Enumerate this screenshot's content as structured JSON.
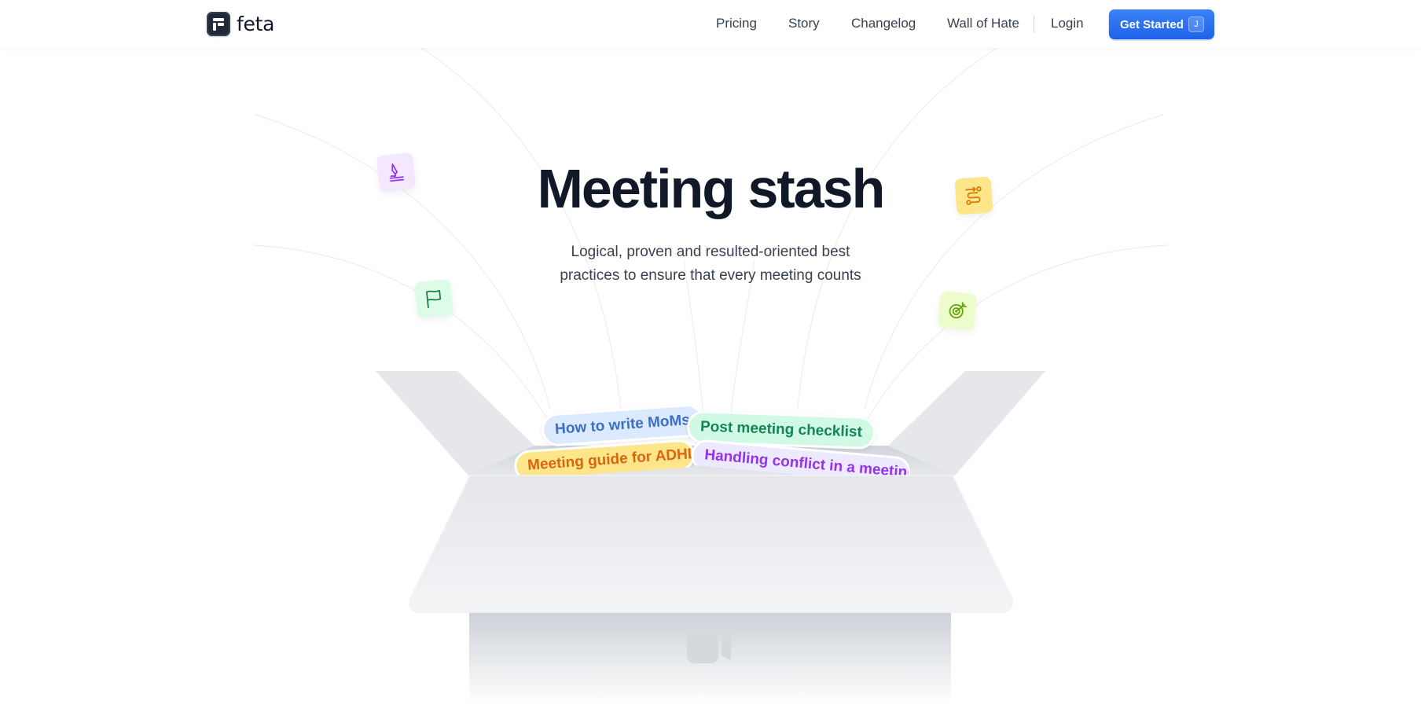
{
  "brand": {
    "name": "feta"
  },
  "nav": {
    "links": [
      "Pricing",
      "Story",
      "Changelog",
      "Wall of Hate"
    ],
    "login": "Login",
    "cta": {
      "label": "Get Started",
      "shortcut": "J"
    }
  },
  "hero": {
    "title": "Meeting stash",
    "subtitle_line1": "Logical, proven and resulted-oriented best",
    "subtitle_line2": "practices to ensure that every meeting counts"
  },
  "icons": [
    "pen-signature-icon",
    "flag-icon",
    "route-icon",
    "target-icon",
    "video-camera-icon"
  ],
  "tags": [
    {
      "label": "How to write MoMs",
      "bg": "#dbeafe",
      "fg": "#3b6fc2"
    },
    {
      "label": "Post meeting checklist",
      "bg": "#d1fae5",
      "fg": "#15845a"
    },
    {
      "label": "Meeting guide for ADHD",
      "bg": "#fde68a",
      "fg": "#d9650f"
    },
    {
      "label": "Handling conflict in a meeting",
      "bg": "#ede9fe",
      "fg": "#9333ea"
    }
  ],
  "colors": {
    "accent": "#2563eb",
    "heading": "#111827",
    "body": "#374151"
  }
}
